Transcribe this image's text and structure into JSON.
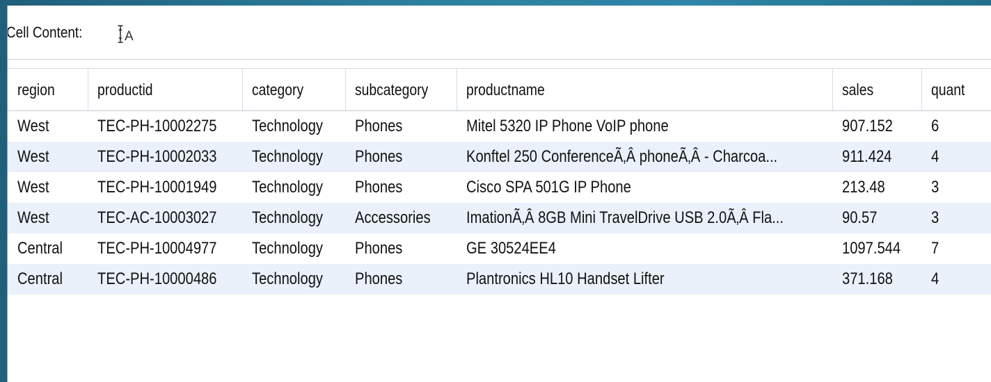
{
  "toolbar": {
    "cell_content_label": "Cell Content:",
    "cell_content_icon": "text-height-icon"
  },
  "table": {
    "columns": [
      "region",
      "productid",
      "category",
      "subcategory",
      "productname",
      "sales",
      "quant"
    ],
    "rows": [
      [
        "West",
        "TEC-PH-10002275",
        "Technology",
        "Phones",
        "Mitel 5320 IP Phone VoIP phone",
        "907.152",
        "6"
      ],
      [
        "West",
        "TEC-PH-10002033",
        "Technology",
        "Phones",
        "Konftel 250 ConferenceÃ‚Â phoneÃ‚Â - Charcoa...",
        "911.424",
        "4"
      ],
      [
        "West",
        "TEC-PH-10001949",
        "Technology",
        "Phones",
        "Cisco SPA 501G IP Phone",
        "213.48",
        "3"
      ],
      [
        "West",
        "TEC-AC-10003027",
        "Technology",
        "Accessories",
        "ImationÃ‚Â 8GB Mini TravelDrive USB 2.0Ã‚Â Fla...",
        "90.57",
        "3"
      ],
      [
        "Central",
        "TEC-PH-10004977",
        "Technology",
        "Phones",
        "GE 30524EE4",
        "1097.544",
        "7"
      ],
      [
        "Central",
        "TEC-PH-10000486",
        "Technology",
        "Phones",
        "Plantronics HL10 Handset Lifter",
        "371.168",
        "4"
      ]
    ]
  }
}
